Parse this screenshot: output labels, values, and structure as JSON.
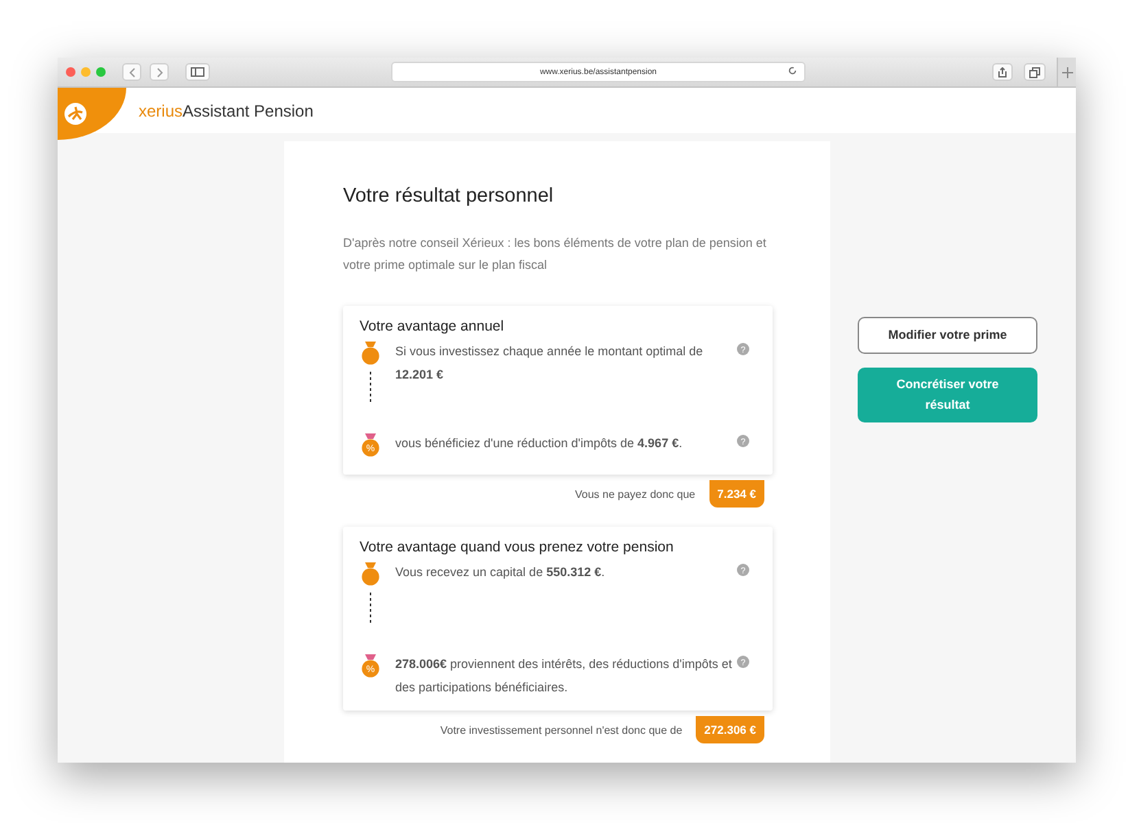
{
  "browser": {
    "url": "www.xerius.be/assistantpension"
  },
  "header": {
    "brand": "xerius",
    "product": "Assistant Pension"
  },
  "result": {
    "title": "Votre résultat personnel",
    "intro": "D'après notre conseil Xérieux : les bons éléments de votre plan de pension et votre prime optimale sur le plan fiscal",
    "cards": [
      {
        "title": "Votre avantage annuel",
        "rows": [
          {
            "kind": "bag",
            "text": "Si vous investissez chaque année le montant optimal de **12.201 €**",
            "help": "?"
          },
          {
            "kind": "percent",
            "badge": "%",
            "text": "vous bénéficiez d'une réduction d'impôts de **4.967 €**.",
            "help": "?"
          }
        ],
        "summary": "Vous ne payez donc que",
        "total": "7.234 €"
      },
      {
        "title": "Votre avantage quand vous prenez votre pension",
        "rows": [
          {
            "kind": "bag",
            "text": "Vous recevez un capital de **550.312 €**.",
            "help": "?"
          },
          {
            "kind": "percent",
            "badge": "%",
            "text": "**278.006€** proviennent des intérêts, des réductions d'impôts et des participations bénéficiaires.",
            "help": "?"
          }
        ],
        "summary": "Votre investissement personnel n'est donc que de",
        "total": "272.306 €"
      }
    ]
  },
  "actions": [
    {
      "label": "Modifier votre prime",
      "kind": "outline"
    },
    {
      "label": "Concrétiser votre résultat",
      "kind": "primary"
    }
  ]
}
